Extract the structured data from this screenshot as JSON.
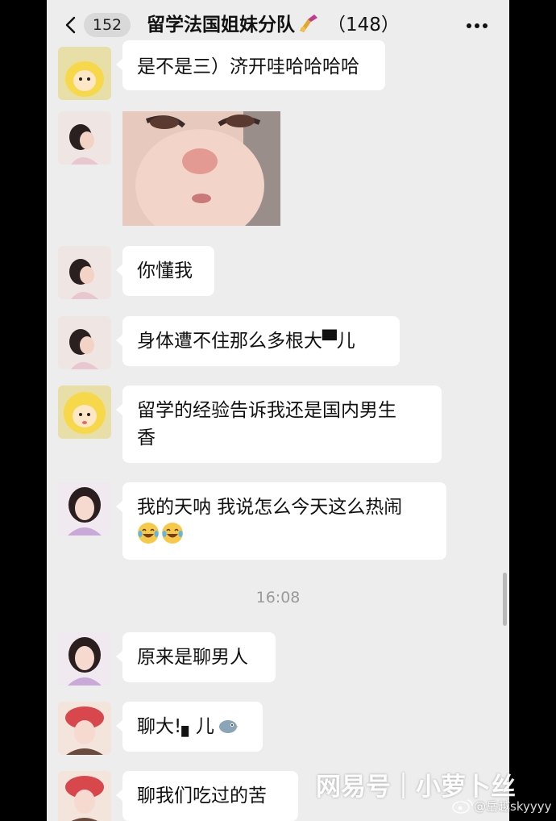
{
  "header": {
    "back_count": "152",
    "title": "留学法国姐妹分队",
    "member_count": "（148）"
  },
  "messages": [
    {
      "type": "text",
      "avatar": "yellow-cartoon-avatar",
      "text": "是不是三）济开哇哈哈哈哈"
    },
    {
      "type": "image",
      "avatar": "girl-avatar-a",
      "description": "baby-sticker"
    },
    {
      "type": "text",
      "avatar": "girl-avatar-a",
      "text": "你懂我"
    },
    {
      "type": "text",
      "avatar": "girl-avatar-a",
      "text": "身体遭不住那么多根大▀儿"
    },
    {
      "type": "text",
      "avatar": "yellow-cartoon-avatar",
      "line1": "留学的经验告诉我还是国内男生",
      "line2": "香"
    },
    {
      "type": "text",
      "avatar": "girl-avatar-b",
      "text": "我的天呐 我说怎么今天这么热闹",
      "emoji": "laughing-tears-emoji"
    },
    {
      "type": "text",
      "avatar": "girl-avatar-b",
      "text": "原来是聊男人"
    },
    {
      "type": "text",
      "avatar": "red-hat-girl-avatar",
      "text": "聊大!▖儿"
    },
    {
      "type": "text",
      "avatar": "red-hat-girl-avatar",
      "text": "聊我们吃过的苦"
    }
  ],
  "timestamp": "16:08",
  "watermark": {
    "brand": "网易号｜小萝卜丝",
    "handle": "@岳越skyyyy"
  },
  "colors": {
    "chat_background": "#ededed",
    "bubble": "#ffffff",
    "frame": "#000000"
  }
}
